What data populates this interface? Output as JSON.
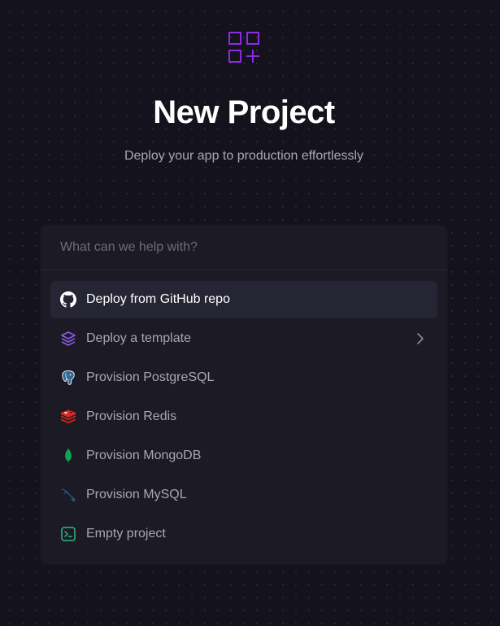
{
  "header": {
    "title": "New Project",
    "subtitle": "Deploy your app to production effortlessly",
    "logo_icon": "grid-plus-icon",
    "accent_color": "#8b2be2"
  },
  "search": {
    "placeholder": "What can we help with?",
    "value": ""
  },
  "options": [
    {
      "label": "Deploy from GitHub repo",
      "icon": "github-icon",
      "selected": true
    },
    {
      "label": "Deploy a template",
      "icon": "layers-icon",
      "has_submenu": true
    },
    {
      "label": "Provision PostgreSQL",
      "icon": "postgresql-icon"
    },
    {
      "label": "Provision Redis",
      "icon": "redis-icon"
    },
    {
      "label": "Provision MongoDB",
      "icon": "mongodb-icon"
    },
    {
      "label": "Provision MySQL",
      "icon": "mysql-icon"
    },
    {
      "label": "Empty project",
      "icon": "terminal-icon"
    }
  ]
}
